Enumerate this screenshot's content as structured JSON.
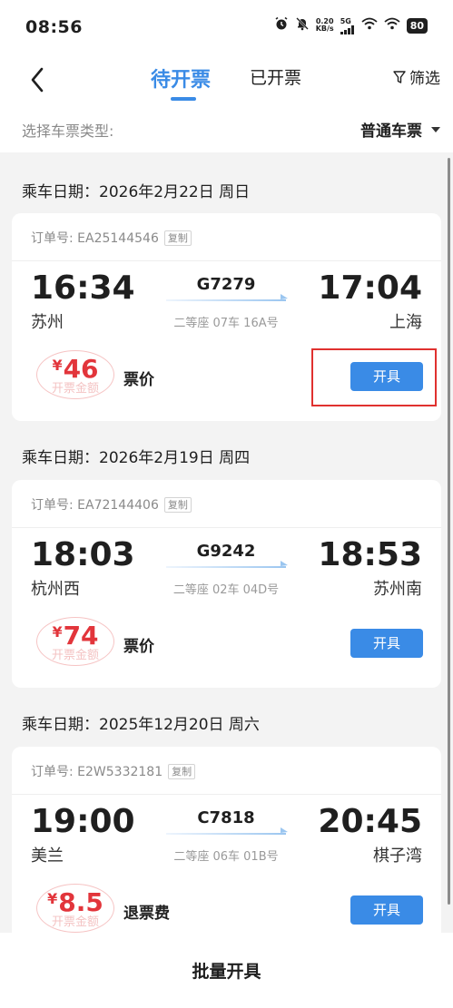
{
  "status_bar": {
    "time": "08:56",
    "net_speed_value": "0.20",
    "net_speed_unit": "KB/s",
    "network_type": "5G",
    "battery": "80"
  },
  "nav": {
    "tabs": [
      {
        "label": "待开票",
        "active": true
      },
      {
        "label": "已开票",
        "active": false
      }
    ],
    "filter_label": "筛选"
  },
  "ticket_type": {
    "label": "选择车票类型:",
    "value": "普通车票"
  },
  "groups": [
    {
      "date_label": "乘车日期：2026年2月22日 周日",
      "order_label": "订单号: EA25144546",
      "copy_label": "复制",
      "train_no": "G7279",
      "dep_time": "16:34",
      "dep_station": "苏州",
      "arr_time": "17:04",
      "arr_station": "上海",
      "seat": "二等座 07车 16A号",
      "price": "46",
      "price_caption": "开票金额",
      "fee_label": "票价",
      "button_label": "开具"
    },
    {
      "date_label": "乘车日期：2026年2月19日 周四",
      "order_label": "订单号: EA72144406",
      "copy_label": "复制",
      "train_no": "G9242",
      "dep_time": "18:03",
      "dep_station": "杭州西",
      "arr_time": "18:53",
      "arr_station": "苏州南",
      "seat": "二等座 02车 04D号",
      "price": "74",
      "price_caption": "开票金额",
      "fee_label": "票价",
      "button_label": "开具"
    },
    {
      "date_label": "乘车日期：2025年12月20日 周六",
      "order_label": "订单号: E2W5332181",
      "copy_label": "复制",
      "train_no": "C7818",
      "dep_time": "19:00",
      "dep_station": "美兰",
      "arr_time": "20:45",
      "arr_station": "棋子湾",
      "seat": "二等座 06车 01B号",
      "price": "8.5",
      "price_caption": "开票金额",
      "fee_label": "退票费",
      "button_label": "开具"
    }
  ],
  "currency_symbol": "¥",
  "batch_button": "批量开具",
  "colors": {
    "accent": "#3a8be6",
    "price": "#e2353b",
    "highlight": "#e0312f"
  }
}
